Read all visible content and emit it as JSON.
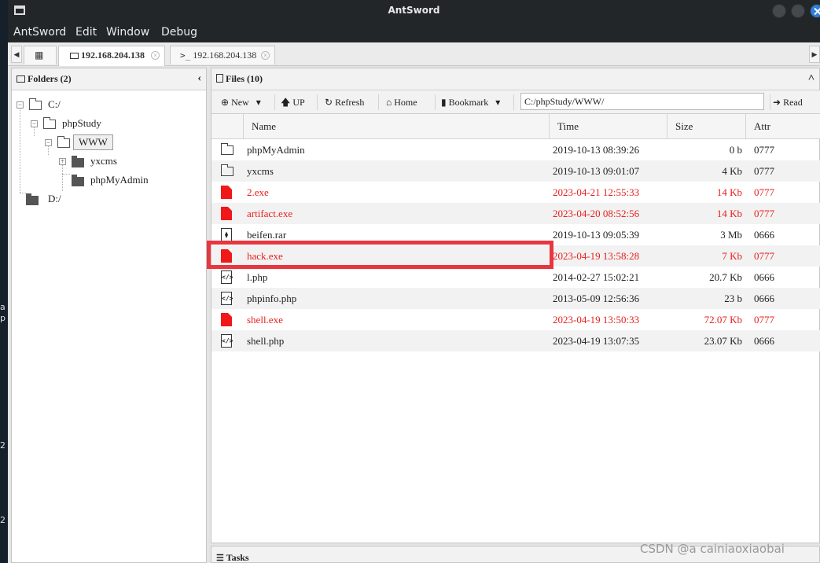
{
  "window": {
    "title": "AntSword"
  },
  "menu": [
    "AntSword",
    "Edit",
    "Window",
    "Debug"
  ],
  "tabs": [
    {
      "label": "192.168.204.138",
      "icon": "folder-icon"
    },
    {
      "label": "192.168.204.138",
      "icon": "terminal-icon"
    }
  ],
  "folders": {
    "header": "Folders (2)",
    "tree": [
      {
        "label": "C:/"
      },
      {
        "label": "phpStudy"
      },
      {
        "label": "WWW"
      },
      {
        "label": "yxcms"
      },
      {
        "label": "phpMyAdmin"
      },
      {
        "label": "D:/"
      }
    ]
  },
  "files": {
    "header": "Files (10)",
    "toolbar": {
      "new": "New",
      "up": "UP",
      "refresh": "Refresh",
      "home": "Home",
      "bookmark": "Bookmark",
      "path": "C:/phpStudy/WWW/",
      "read": "Read"
    },
    "columns": [
      "Name",
      "Time",
      "Size",
      "Attr"
    ],
    "rows": [
      {
        "name": "phpMyAdmin",
        "time": "2019-10-13 08:39:26",
        "size": "0 b",
        "attr": "0777",
        "type": "folder"
      },
      {
        "name": "yxcms",
        "time": "2019-10-13 09:01:07",
        "size": "4 Kb",
        "attr": "0777",
        "type": "folder"
      },
      {
        "name": "2.exe",
        "time": "2023-04-21 12:55:33",
        "size": "14 Kb",
        "attr": "0777",
        "type": "exe"
      },
      {
        "name": "artifact.exe",
        "time": "2023-04-20 08:52:56",
        "size": "14 Kb",
        "attr": "0777",
        "type": "exe"
      },
      {
        "name": "beifen.rar",
        "time": "2019-10-13 09:05:39",
        "size": "3 Mb",
        "attr": "0666",
        "type": "archive"
      },
      {
        "name": "hack.exe",
        "time": "2023-04-19 13:58:28",
        "size": "7 Kb",
        "attr": "0777",
        "type": "exe"
      },
      {
        "name": "l.php",
        "time": "2014-02-27 15:02:21",
        "size": "20.7 Kb",
        "attr": "0666",
        "type": "php"
      },
      {
        "name": "phpinfo.php",
        "time": "2013-05-09 12:56:36",
        "size": "23 b",
        "attr": "0666",
        "type": "php"
      },
      {
        "name": "shell.exe",
        "time": "2023-04-19 13:50:33",
        "size": "72.07 Kb",
        "attr": "0777",
        "type": "exe"
      },
      {
        "name": "shell.php",
        "time": "2023-04-19 13:07:35",
        "size": "23.07 Kb",
        "attr": "0666",
        "type": "php"
      }
    ]
  },
  "tasks": {
    "header": "Tasks"
  },
  "desktop_edge": [
    "a",
    "p",
    "2",
    "2"
  ],
  "watermark": "CSDN @a cainiaoxiaobai",
  "colors": {
    "exe_red": "#e8201c",
    "highlight": "#e8363f",
    "close_button": "#2f7fd8"
  }
}
